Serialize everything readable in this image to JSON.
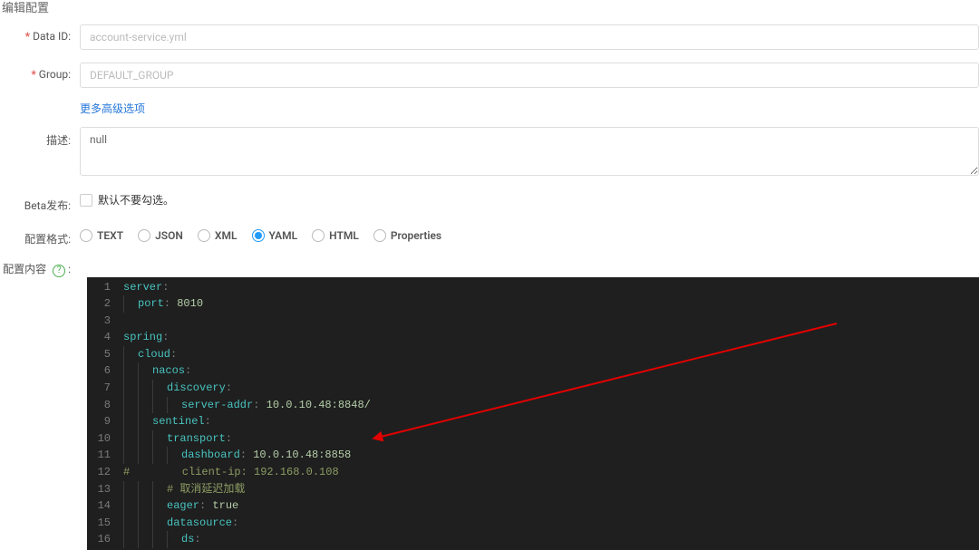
{
  "header": {
    "title": "编辑配置"
  },
  "form": {
    "dataId": {
      "label": "Data ID:",
      "value": "account-service.yml"
    },
    "group": {
      "label": "Group:",
      "value": "DEFAULT_GROUP"
    },
    "advancedLink": "更多高级选项",
    "desc": {
      "label": "描述:",
      "value": "null"
    },
    "beta": {
      "label": "Beta发布:",
      "note": "默认不要勾选。"
    },
    "format": {
      "label": "配置格式:",
      "selected": "YAML",
      "options": [
        "TEXT",
        "JSON",
        "XML",
        "YAML",
        "HTML",
        "Properties"
      ]
    },
    "content": {
      "label": "配置内容",
      "help": "?"
    }
  },
  "editor": {
    "lines": [
      {
        "tokens": [
          [
            "k",
            "server"
          ],
          [
            "c",
            ":"
          ]
        ]
      },
      {
        "indent": 1,
        "tokens": [
          [
            "k",
            "port"
          ],
          [
            "c",
            ": "
          ],
          [
            "n",
            "8010"
          ]
        ]
      },
      {
        "tokens": []
      },
      {
        "tokens": [
          [
            "k",
            "spring"
          ],
          [
            "c",
            ":"
          ]
        ]
      },
      {
        "indent": 1,
        "tokens": [
          [
            "k",
            "cloud"
          ],
          [
            "c",
            ":"
          ]
        ]
      },
      {
        "indent": 2,
        "tokens": [
          [
            "k",
            "nacos"
          ],
          [
            "c",
            ":"
          ]
        ]
      },
      {
        "indent": 3,
        "tokens": [
          [
            "k",
            "discovery"
          ],
          [
            "c",
            ":"
          ]
        ]
      },
      {
        "indent": 4,
        "tokens": [
          [
            "k",
            "server-addr"
          ],
          [
            "c",
            ": "
          ],
          [
            "n",
            "10.0.10.48:8848/"
          ]
        ]
      },
      {
        "indent": 2,
        "tokens": [
          [
            "k",
            "sentinel"
          ],
          [
            "c",
            ":"
          ]
        ]
      },
      {
        "indent": 3,
        "tokens": [
          [
            "k",
            "transport"
          ],
          [
            "c",
            ":"
          ]
        ]
      },
      {
        "indent": 4,
        "tokens": [
          [
            "k",
            "dashboard"
          ],
          [
            "c",
            ": "
          ],
          [
            "n",
            "10.0.10.48:8858"
          ]
        ]
      },
      {
        "indent": 0,
        "tokens": [
          [
            "cm",
            "#        client-ip: 192.168.0.108"
          ]
        ]
      },
      {
        "indent": 3,
        "tokens": [
          [
            "cm",
            "# 取消延迟加载"
          ]
        ]
      },
      {
        "indent": 3,
        "tokens": [
          [
            "k",
            "eager"
          ],
          [
            "c",
            ": "
          ],
          [
            "n",
            "true"
          ]
        ]
      },
      {
        "indent": 3,
        "tokens": [
          [
            "k",
            "datasource"
          ],
          [
            "c",
            ":"
          ]
        ]
      },
      {
        "indent": 4,
        "tokens": [
          [
            "k",
            "ds"
          ],
          [
            "c",
            ":"
          ]
        ]
      }
    ]
  },
  "annotation": {
    "arrowColor": "#e20000"
  }
}
